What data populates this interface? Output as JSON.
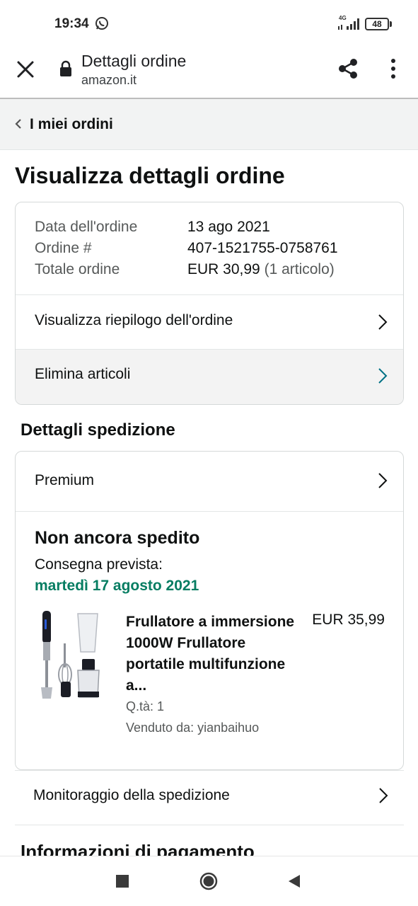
{
  "status_bar": {
    "time": "19:34",
    "network": "4G",
    "battery": "48",
    "icons": [
      "whatsapp-icon",
      "signal-icon",
      "battery-icon"
    ]
  },
  "browser": {
    "title": "Dettagli ordine",
    "url": "amazon.it",
    "icons": [
      "close-icon",
      "lock-icon",
      "share-icon",
      "more-vert-icon"
    ]
  },
  "breadcrumb": {
    "label": "I miei ordini"
  },
  "page": {
    "title": "Visualizza dettagli ordine"
  },
  "order_summary": {
    "date_label": "Data dell'ordine",
    "date_value": "13 ago 2021",
    "number_label": "Ordine #",
    "number_value": "407-1521755-0758761",
    "total_label": "Totale ordine",
    "total_value": "EUR 30,99",
    "total_items": "(1 articolo)",
    "summary_link": "Visualizza riepilogo dell'ordine",
    "delete_link": "Elimina articoli"
  },
  "shipping": {
    "section_title": "Dettagli spedizione",
    "method": "Premium",
    "status": "Non ancora spedito",
    "delivery_label": "Consegna prevista:",
    "delivery_date": "martedì 17 agosto 2021",
    "item": {
      "title": "Frullatore a immersione 1000W Frullatore portatile multifunzione a...",
      "price": "EUR 35,99",
      "quantity": "Q.tà: 1",
      "seller": "Venduto da: yianbaihuo"
    },
    "tracking_link": "Monitoraggio della spedizione"
  },
  "payment": {
    "section_title": "Informazioni di pagamento"
  },
  "colors": {
    "accent_teal": "#007185",
    "delivery_green": "#067d62",
    "secondary_text": "#565959",
    "highlight_row": "#f3f3f3"
  }
}
